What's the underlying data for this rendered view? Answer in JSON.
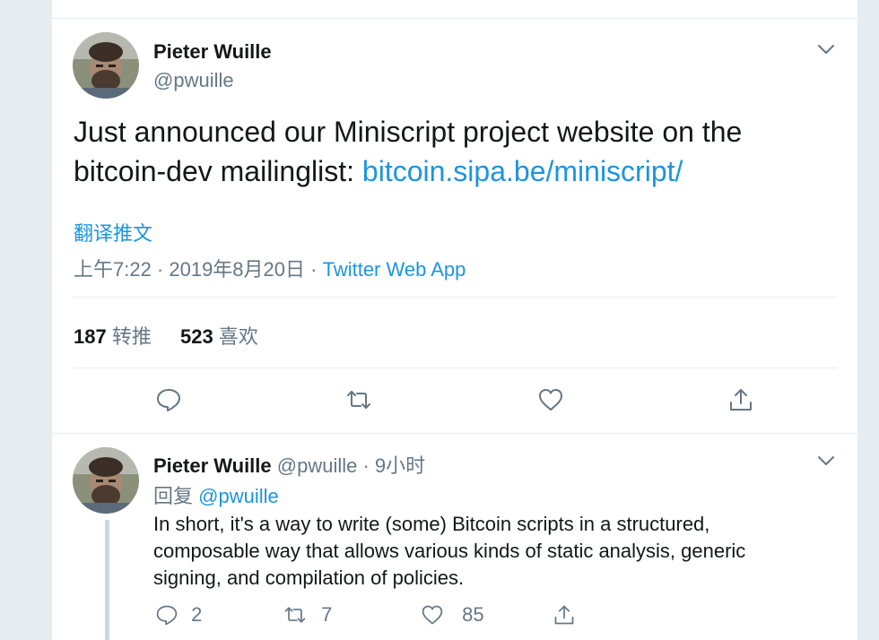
{
  "main_tweet": {
    "name": "Pieter Wuille",
    "handle": "@pwuille",
    "text_before": "Just announced our Miniscript project website on the bitcoin-dev mailinglist: ",
    "link": "bitcoin.sipa.be/miniscript/",
    "translate": "翻译推文",
    "timestamp": "上午7:22 · 2019年8月20日",
    "separator": " · ",
    "app": "Twitter Web App",
    "retweets_count": "187",
    "retweets_label": "转推",
    "likes_count": "523",
    "likes_label": "喜欢"
  },
  "reply_tweet": {
    "name": "Pieter Wuille",
    "handle": "@pwuille",
    "time": "· 9小时",
    "reply_label": "回复",
    "reply_handle": "@pwuille",
    "text": "In short, it's a way to write (some) Bitcoin scripts in a structured, composable way that allows various kinds of static analysis, generic signing, and compilation of policies.",
    "reply_count": "2",
    "retweet_count": "7",
    "like_count": "85"
  },
  "icons": [
    "chevron-down-icon",
    "reply-icon",
    "retweet-icon",
    "like-icon",
    "share-icon"
  ],
  "colors": {
    "link": "#1b95e0",
    "muted": "#657786",
    "text": "#14171a",
    "border": "#e6ecf0"
  }
}
